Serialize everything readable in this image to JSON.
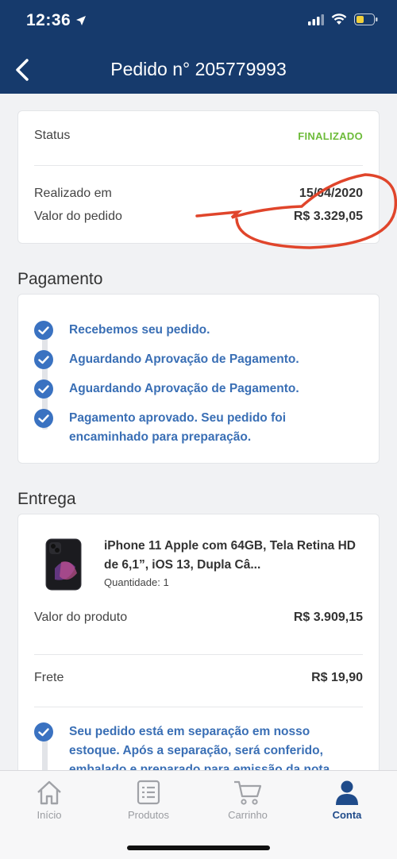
{
  "status_bar": {
    "time": "12:36"
  },
  "header": {
    "title": "Pedido n° 205779993"
  },
  "summary": {
    "status_label": "Status",
    "status_value": "FINALIZADO",
    "date_label": "Realizado em",
    "date_value": "15/04/2020",
    "total_label": "Valor do pedido",
    "total_value": "R$  3.329,05"
  },
  "payment": {
    "title": "Pagamento",
    "steps": [
      "Recebemos seu pedido.",
      "Aguardando Aprovação de Pagamento.",
      "Aguardando Aprovação de Pagamento.",
      "Pagamento aprovado. Seu pedido foi encaminhado para preparação."
    ]
  },
  "delivery": {
    "title": "Entrega",
    "product_name": "iPhone 11 Apple com 64GB, Tela Retina HD de 6,1”, iOS 13, Dupla Câ...",
    "quantity": "Quantidade: 1",
    "product_value_label": "Valor do produto",
    "product_value": "R$  3.909,15",
    "shipping_label": "Frete",
    "shipping_value": "R$  19,90",
    "step": "Seu pedido está em separação em nosso estoque. Após a separação, será conferido, embalado e preparado para emissão da nota"
  },
  "tabbar": {
    "items": [
      {
        "label": "Início",
        "icon": "home-icon"
      },
      {
        "label": "Produtos",
        "icon": "list-icon"
      },
      {
        "label": "Carrinho",
        "icon": "cart-icon"
      },
      {
        "label": "Conta",
        "icon": "user-icon",
        "active": true
      }
    ]
  },
  "colors": {
    "header_bg": "#163a6c",
    "status_green": "#6dbb3a",
    "step_blue": "#3a72c1",
    "active_tab": "#1f4b8a",
    "annotation_red": "#e0452b"
  }
}
